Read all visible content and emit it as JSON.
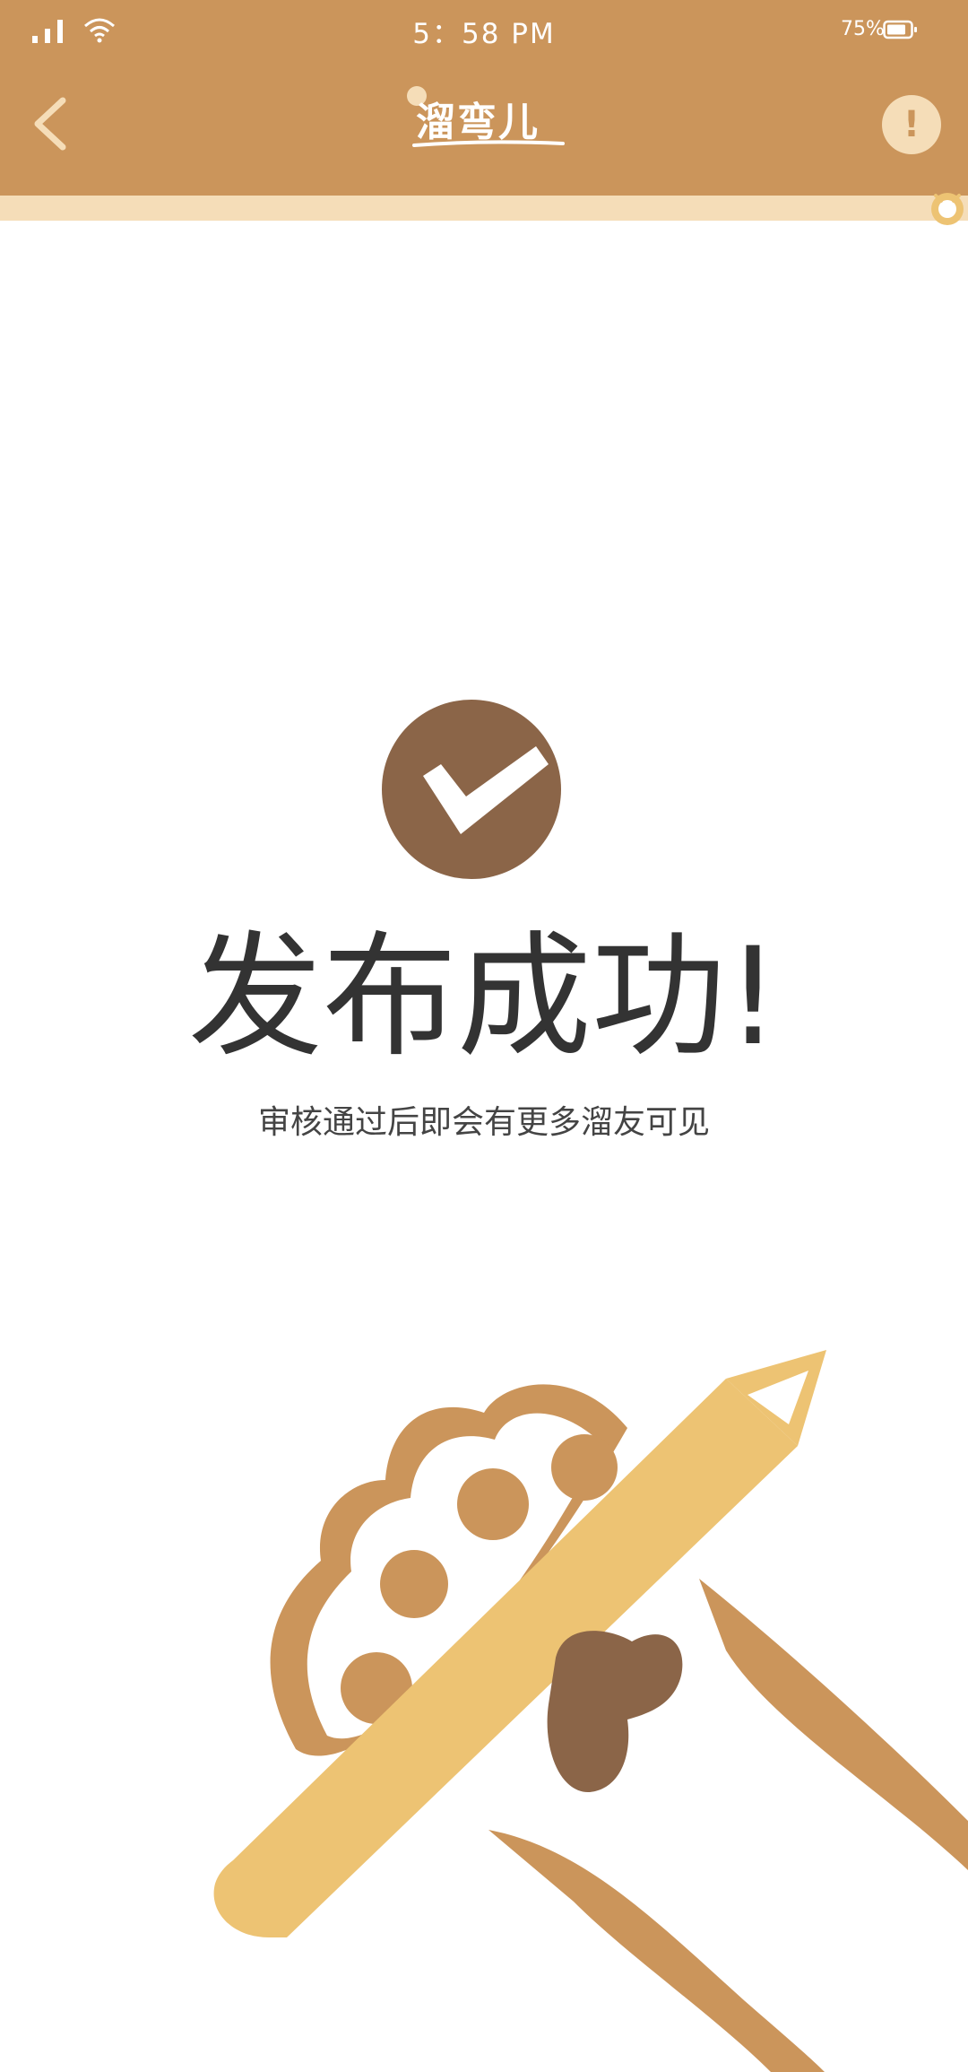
{
  "status_bar": {
    "time": "5：58 PM",
    "battery_percent": "75%",
    "icons": [
      "signal-icon",
      "wifi-icon",
      "battery-icon"
    ]
  },
  "header": {
    "logo_text": "溜弯儿",
    "back_icon": "back-chevron-icon",
    "info_label": "!"
  },
  "main": {
    "title": "发布成功!",
    "subtitle": "审核通过后即会有更多溜友可见"
  },
  "colors": {
    "header_bg": "#CB955B",
    "accent_light": "#F5DDB8",
    "check_circle": "#8B6548",
    "paw": "#CB955B",
    "pencil": "#EDC373",
    "text_dark": "#333333"
  }
}
